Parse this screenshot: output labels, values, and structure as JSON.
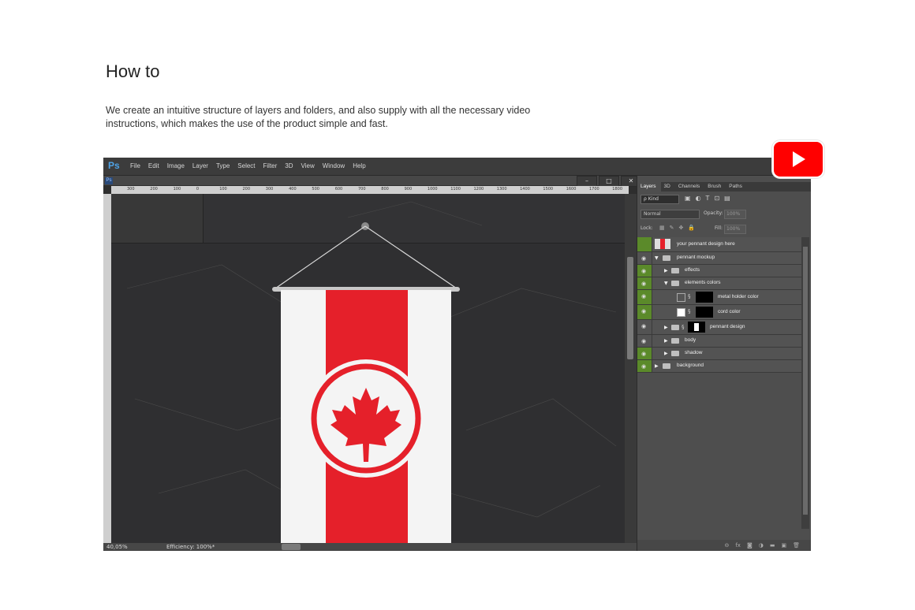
{
  "page": {
    "heading": "How to",
    "description": "We create an intuitive structure of layers and folders, and also supply with all the necessary video instructions, which makes the use of the product simple and fast."
  },
  "app": {
    "logo": "Ps",
    "menu": [
      "File",
      "Edit",
      "Image",
      "Layer",
      "Type",
      "Select",
      "Filter",
      "3D",
      "View",
      "Window",
      "Help"
    ],
    "mini_logo": "Ps",
    "window_buttons": [
      "–",
      "□",
      "✕"
    ]
  },
  "ruler": {
    "h_ticks": [
      "300",
      "200",
      "100",
      "0",
      "100",
      "200",
      "300",
      "400",
      "500",
      "600",
      "700",
      "800",
      "900",
      "1000",
      "1100",
      "1200",
      "1300",
      "1400",
      "1500",
      "1600",
      "1700",
      "1800"
    ]
  },
  "status": {
    "zoom": "40,05%",
    "efficiency": "Efficiency: 100%*"
  },
  "panel": {
    "tabs": [
      "Layers",
      "3D",
      "Channels",
      "Brush",
      "Paths"
    ],
    "kind": "ρ Kind",
    "blend_mode": "Normal",
    "opacity_label": "Opacity:",
    "opacity_value": "100%",
    "lock_label": "Lock:",
    "fill_label": "Fill:",
    "fill_value": "100%",
    "layers": [
      {
        "name": "your pennant design here",
        "visible": false
      },
      {
        "name": "pennant mockup",
        "visible": false
      },
      {
        "name": "effects",
        "visible": true
      },
      {
        "name": "elements colors",
        "visible": true
      },
      {
        "name": "metal holder color",
        "visible": true
      },
      {
        "name": "cord color",
        "visible": true
      },
      {
        "name": "pennant design",
        "visible": false
      },
      {
        "name": "body",
        "visible": false
      },
      {
        "name": "shadow",
        "visible": true
      },
      {
        "name": "background",
        "visible": true
      }
    ]
  },
  "colors": {
    "flag_red": "#e5202a",
    "flag_white": "#f4f4f4",
    "visibility_green": "#5b8a2a",
    "youtube_red": "#ff0000"
  },
  "icons": {
    "youtube": "youtube-play-icon",
    "eye": "eye-icon",
    "folder": "folder-icon",
    "maple_leaf": "maple-leaf-icon"
  }
}
